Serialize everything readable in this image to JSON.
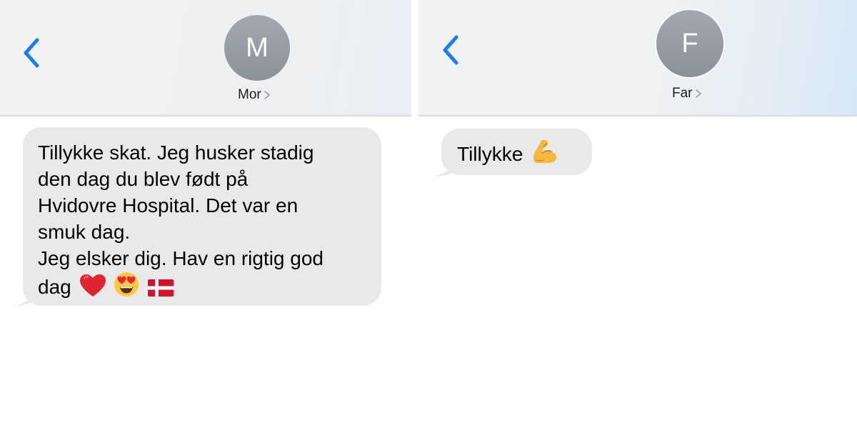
{
  "left_conversation": {
    "contact": {
      "initial": "M",
      "name": "Mor"
    },
    "message": {
      "lines": [
        "Tillykke skat. Jeg husker stadig",
        "den dag du blev født på",
        "Hvidovre Hospital. Det var en",
        "smuk dag.",
        "Jeg elsker dig. Hav en rigtig god",
        "dag"
      ],
      "emojis": [
        "red-heart-emoji",
        "heart-eyes-emoji",
        "danish-flag-emoji"
      ]
    }
  },
  "right_conversation": {
    "contact": {
      "initial": "F",
      "name": "Far"
    },
    "message": {
      "text": "Tillykke",
      "emojis": [
        "flexed-biceps-emoji"
      ]
    }
  },
  "colors": {
    "accent": "#1a7cf5",
    "bubble_received": "#e9e9eb",
    "avatar": "#979ca5",
    "header_background": "#f0f1f3"
  }
}
